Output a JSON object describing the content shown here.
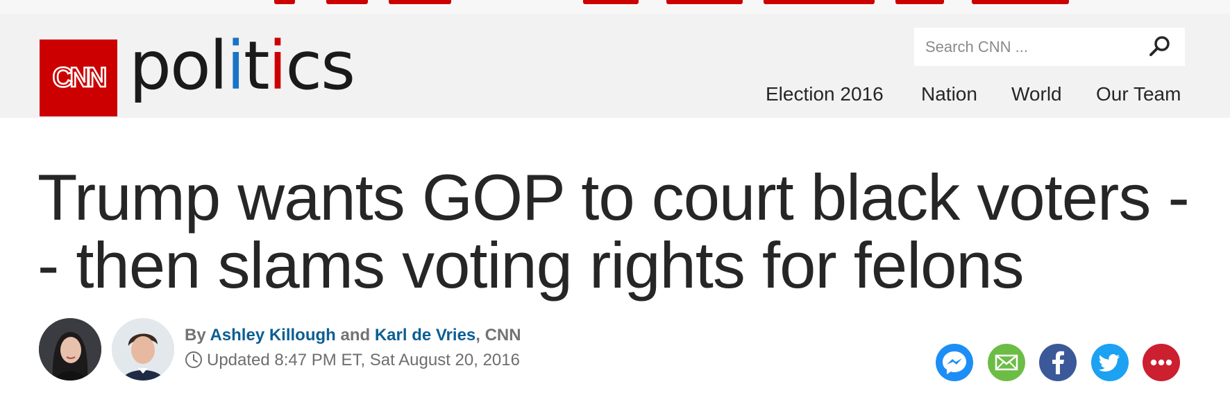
{
  "colors": {
    "brand_red": "#cc0000",
    "header_bg": "#f2f2f2",
    "section_blue": "#1a73c6",
    "author_link": "#0c5e93",
    "messenger": "#1d8ef5",
    "email": "#6cbd45",
    "facebook": "#3b5998",
    "twitter": "#1da1f2",
    "more": "#cc1f2f"
  },
  "header": {
    "logo_text": "CNN",
    "section": {
      "part1": "pol",
      "accent1": "i",
      "part2": "t",
      "accent2": "i",
      "part3": "cs"
    },
    "search_placeholder": "Search CNN ...",
    "nav": [
      "Election 2016",
      "Nation",
      "World",
      "Our Team"
    ]
  },
  "article": {
    "headline": "Trump wants GOP to court black voters -- then slams voting rights for felons",
    "byline": {
      "prefix": "By",
      "author1": "Ashley Killough",
      "joiner": "and",
      "author2": "Karl de Vries",
      "source": ", CNN"
    },
    "updated": "Updated 8:47 PM ET, Sat August 20, 2016"
  },
  "share_icons": [
    "messenger-icon",
    "email-icon",
    "facebook-icon",
    "twitter-icon",
    "more-icon"
  ]
}
